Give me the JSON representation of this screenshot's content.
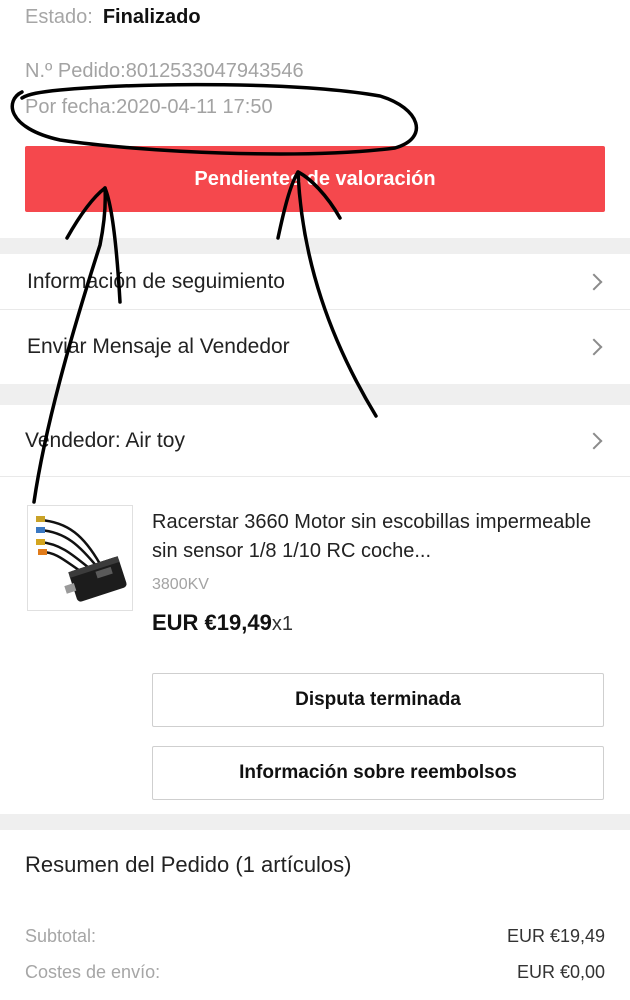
{
  "order": {
    "status_label": "Estado:",
    "status_value": "Finalizado",
    "order_number": "N.º Pedido:8012533047943546",
    "order_date": "Por fecha:2020-04-11 17:50",
    "primary_action": "Pendientes de valoración"
  },
  "nav": {
    "tracking": "Información de seguimiento",
    "message": "Enviar Mensaje al Vendedor"
  },
  "seller": {
    "label": "Vendedor: Air toy"
  },
  "product": {
    "title": "Racerstar 3660 Motor sin escobillas impermeable sin sensor 1/8 1/10 RC coche...",
    "variant": "3800KV",
    "price": "EUR €19,49",
    "quantity": "x1",
    "image_icon": "motor-product-image"
  },
  "actions": {
    "dispute": "Disputa terminada",
    "refund": "Información sobre reembolsos"
  },
  "summary": {
    "title": "Resumen del Pedido (1 artículos)",
    "subtotal_label": "Subtotal:",
    "subtotal_value": "EUR €19,49",
    "shipping_label": "Costes de envío:",
    "shipping_value": "EUR €0,00"
  },
  "colors": {
    "accent": "#f5484d",
    "separator": "#efefef"
  }
}
